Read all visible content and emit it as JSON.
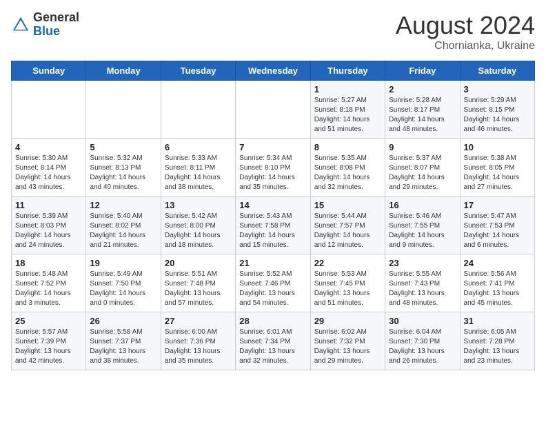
{
  "header": {
    "logo_line1": "General",
    "logo_line2": "Blue",
    "month_year": "August 2024",
    "location": "Chornianka, Ukraine"
  },
  "weekdays": [
    "Sunday",
    "Monday",
    "Tuesday",
    "Wednesday",
    "Thursday",
    "Friday",
    "Saturday"
  ],
  "weeks": [
    [
      {
        "day": "",
        "info": ""
      },
      {
        "day": "",
        "info": ""
      },
      {
        "day": "",
        "info": ""
      },
      {
        "day": "",
        "info": ""
      },
      {
        "day": "1",
        "info": "Sunrise: 5:27 AM\nSunset: 8:18 PM\nDaylight: 14 hours and 51 minutes."
      },
      {
        "day": "2",
        "info": "Sunrise: 5:28 AM\nSunset: 8:17 PM\nDaylight: 14 hours and 48 minutes."
      },
      {
        "day": "3",
        "info": "Sunrise: 5:29 AM\nSunset: 8:15 PM\nDaylight: 14 hours and 46 minutes."
      }
    ],
    [
      {
        "day": "4",
        "info": "Sunrise: 5:30 AM\nSunset: 8:14 PM\nDaylight: 14 hours and 43 minutes."
      },
      {
        "day": "5",
        "info": "Sunrise: 5:32 AM\nSunset: 8:13 PM\nDaylight: 14 hours and 40 minutes."
      },
      {
        "day": "6",
        "info": "Sunrise: 5:33 AM\nSunset: 8:11 PM\nDaylight: 14 hours and 38 minutes."
      },
      {
        "day": "7",
        "info": "Sunrise: 5:34 AM\nSunset: 8:10 PM\nDaylight: 14 hours and 35 minutes."
      },
      {
        "day": "8",
        "info": "Sunrise: 5:35 AM\nSunset: 8:08 PM\nDaylight: 14 hours and 32 minutes."
      },
      {
        "day": "9",
        "info": "Sunrise: 5:37 AM\nSunset: 8:07 PM\nDaylight: 14 hours and 29 minutes."
      },
      {
        "day": "10",
        "info": "Sunrise: 5:38 AM\nSunset: 8:05 PM\nDaylight: 14 hours and 27 minutes."
      }
    ],
    [
      {
        "day": "11",
        "info": "Sunrise: 5:39 AM\nSunset: 8:03 PM\nDaylight: 14 hours and 24 minutes."
      },
      {
        "day": "12",
        "info": "Sunrise: 5:40 AM\nSunset: 8:02 PM\nDaylight: 14 hours and 21 minutes."
      },
      {
        "day": "13",
        "info": "Sunrise: 5:42 AM\nSunset: 8:00 PM\nDaylight: 14 hours and 18 minutes."
      },
      {
        "day": "14",
        "info": "Sunrise: 5:43 AM\nSunset: 7:58 PM\nDaylight: 14 hours and 15 minutes."
      },
      {
        "day": "15",
        "info": "Sunrise: 5:44 AM\nSunset: 7:57 PM\nDaylight: 14 hours and 12 minutes."
      },
      {
        "day": "16",
        "info": "Sunrise: 5:46 AM\nSunset: 7:55 PM\nDaylight: 14 hours and 9 minutes."
      },
      {
        "day": "17",
        "info": "Sunrise: 5:47 AM\nSunset: 7:53 PM\nDaylight: 14 hours and 6 minutes."
      }
    ],
    [
      {
        "day": "18",
        "info": "Sunrise: 5:48 AM\nSunset: 7:52 PM\nDaylight: 14 hours and 3 minutes."
      },
      {
        "day": "19",
        "info": "Sunrise: 5:49 AM\nSunset: 7:50 PM\nDaylight: 14 hours and 0 minutes."
      },
      {
        "day": "20",
        "info": "Sunrise: 5:51 AM\nSunset: 7:48 PM\nDaylight: 13 hours and 57 minutes."
      },
      {
        "day": "21",
        "info": "Sunrise: 5:52 AM\nSunset: 7:46 PM\nDaylight: 13 hours and 54 minutes."
      },
      {
        "day": "22",
        "info": "Sunrise: 5:53 AM\nSunset: 7:45 PM\nDaylight: 13 hours and 51 minutes."
      },
      {
        "day": "23",
        "info": "Sunrise: 5:55 AM\nSunset: 7:43 PM\nDaylight: 13 hours and 48 minutes."
      },
      {
        "day": "24",
        "info": "Sunrise: 5:56 AM\nSunset: 7:41 PM\nDaylight: 13 hours and 45 minutes."
      }
    ],
    [
      {
        "day": "25",
        "info": "Sunrise: 5:57 AM\nSunset: 7:39 PM\nDaylight: 13 hours and 42 minutes."
      },
      {
        "day": "26",
        "info": "Sunrise: 5:58 AM\nSunset: 7:37 PM\nDaylight: 13 hours and 38 minutes."
      },
      {
        "day": "27",
        "info": "Sunrise: 6:00 AM\nSunset: 7:36 PM\nDaylight: 13 hours and 35 minutes."
      },
      {
        "day": "28",
        "info": "Sunrise: 6:01 AM\nSunset: 7:34 PM\nDaylight: 13 hours and 32 minutes."
      },
      {
        "day": "29",
        "info": "Sunrise: 6:02 AM\nSunset: 7:32 PM\nDaylight: 13 hours and 29 minutes."
      },
      {
        "day": "30",
        "info": "Sunrise: 6:04 AM\nSunset: 7:30 PM\nDaylight: 13 hours and 26 minutes."
      },
      {
        "day": "31",
        "info": "Sunrise: 6:05 AM\nSunset: 7:28 PM\nDaylight: 13 hours and 23 minutes."
      }
    ]
  ]
}
